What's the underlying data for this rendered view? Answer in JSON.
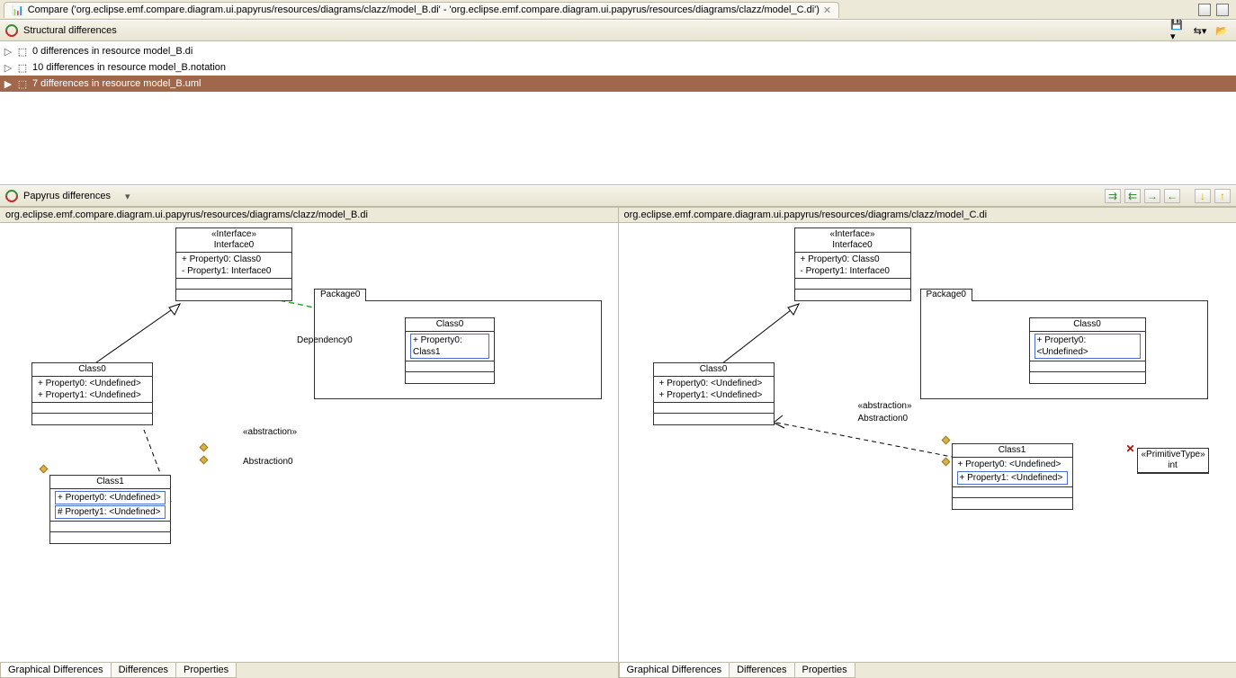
{
  "window": {
    "title_prefix": "Compare",
    "title_full": "Compare ('org.eclipse.emf.compare.diagram.ui.papyrus/resources/diagrams/clazz/model_B.di' - 'org.eclipse.emf.compare.diagram.ui.papyrus/resources/diagrams/clazz/model_C.di')"
  },
  "structural": {
    "header": "Structural differences",
    "rows": [
      {
        "label": "0 differences in resource model_B.di",
        "selected": false
      },
      {
        "label": "10 differences in resource model_B.notation",
        "selected": false
      },
      {
        "label": "7 differences in resource model_B.uml",
        "selected": true
      }
    ]
  },
  "papyrus": {
    "header": "Papyrus differences"
  },
  "left": {
    "path": "org.eclipse.emf.compare.diagram.ui.papyrus/resources/diagrams/clazz/model_B.di",
    "interface": {
      "stereotype": "«Interface»",
      "name": "Interface0",
      "props": [
        "+ Property0: Class0",
        "- Property1: Interface0"
      ]
    },
    "class0": {
      "name": "Class0",
      "props": [
        "+ Property0: <Undefined>",
        "+ Property1: <Undefined>"
      ]
    },
    "pkg": {
      "name": "Package0"
    },
    "pkg_class": {
      "name": "Class0",
      "prop_boxed": "+ Property0: Class1"
    },
    "class1": {
      "name": "Class1",
      "prop_boxed1": "+ Property0: <Undefined>",
      "prop_boxed2": "# Property1: <Undefined>"
    },
    "dep_label": "Dependency0",
    "abs_stereo": "«abstraction»",
    "abs_label": "Abstraction0",
    "tabs": [
      "Graphical Differences",
      "Differences",
      "Properties"
    ]
  },
  "right": {
    "path": "org.eclipse.emf.compare.diagram.ui.papyrus/resources/diagrams/clazz/model_C.di",
    "interface": {
      "stereotype": "«Interface»",
      "name": "Interface0",
      "props": [
        "+ Property0: Class0",
        "- Property1: Interface0"
      ]
    },
    "class0": {
      "name": "Class0",
      "props": [
        "+ Property0: <Undefined>",
        "+ Property1: <Undefined>"
      ]
    },
    "pkg": {
      "name": "Package0"
    },
    "pkg_class": {
      "name": "Class0",
      "prop_boxed": "+ Property0: <Undefined>"
    },
    "class1": {
      "name": "Class1",
      "props": [
        "+ Property0: <Undefined>"
      ],
      "prop_boxed": "+ Property1: <Undefined>"
    },
    "prim": {
      "stereotype": "«PrimitiveType»",
      "name": "int"
    },
    "abs_stereo": "«abstraction»",
    "abs_label": "Abstraction0",
    "tabs": [
      "Graphical Differences",
      "Differences",
      "Properties"
    ]
  }
}
